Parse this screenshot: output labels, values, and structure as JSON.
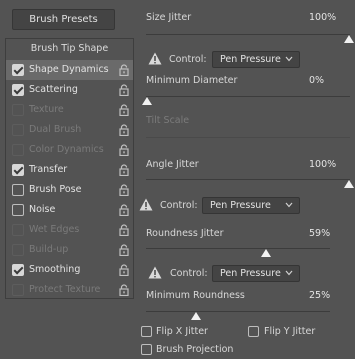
{
  "presets_button": "Brush Presets",
  "tip_header": "Brush Tip Shape",
  "tip_items": [
    {
      "label": "Shape Dynamics",
      "checked": true,
      "enabled": true
    },
    {
      "label": "Scattering",
      "checked": true,
      "enabled": true
    },
    {
      "label": "Texture",
      "checked": false,
      "enabled": false
    },
    {
      "label": "Dual Brush",
      "checked": false,
      "enabled": false
    },
    {
      "label": "Color Dynamics",
      "checked": false,
      "enabled": false
    },
    {
      "label": "Transfer",
      "checked": true,
      "enabled": true
    },
    {
      "label": "Brush Pose",
      "checked": false,
      "enabled": true
    },
    {
      "label": "Noise",
      "checked": false,
      "enabled": true
    },
    {
      "label": "Wet Edges",
      "checked": false,
      "enabled": false
    },
    {
      "label": "Build-up",
      "checked": false,
      "enabled": false
    },
    {
      "label": "Smoothing",
      "checked": true,
      "enabled": true
    },
    {
      "label": "Protect Texture",
      "checked": false,
      "enabled": false
    }
  ],
  "size_jitter": {
    "label": "Size Jitter",
    "value": "100%",
    "level": 1.0
  },
  "control_1": {
    "label": "Control:",
    "value": "Pen Pressure"
  },
  "min_diameter": {
    "label": "Minimum Diameter",
    "value": "0%",
    "level": 0.0
  },
  "tilt_scale": {
    "label": "Tilt Scale"
  },
  "angle_jitter": {
    "label": "Angle Jitter",
    "value": "100%",
    "level": 1.0
  },
  "control_2": {
    "label": "Control:",
    "value": "Pen Pressure"
  },
  "roundness_jitter": {
    "label": "Roundness Jitter",
    "value": "59%",
    "level": 0.59
  },
  "control_3": {
    "label": "Control:",
    "value": "Pen Pressure"
  },
  "min_roundness": {
    "label": "Minimum Roundness",
    "value": "25%",
    "level": 0.25
  },
  "flip_x": {
    "label": "Flip X Jitter",
    "checked": false
  },
  "flip_y": {
    "label": "Flip Y Jitter",
    "checked": false
  },
  "brush_projection": {
    "label": "Brush Projection",
    "checked": false
  }
}
